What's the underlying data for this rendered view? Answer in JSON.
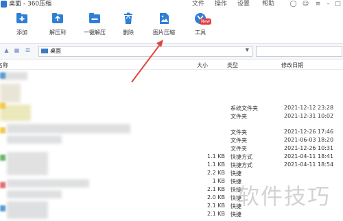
{
  "window": {
    "title": "桌面 - 360压缩",
    "menus": [
      "文件",
      "操作",
      "设置",
      "帮助"
    ]
  },
  "toolbar": {
    "items": [
      {
        "label": "添加",
        "icon": "add-icon"
      },
      {
        "label": "解压到",
        "icon": "extract-to-icon"
      },
      {
        "label": "一键解压",
        "icon": "one-click-extract-icon"
      },
      {
        "label": "删除",
        "icon": "delete-icon"
      },
      {
        "label": "图片压缩",
        "icon": "image-compress-icon"
      },
      {
        "label": "工具",
        "icon": "tools-icon"
      }
    ],
    "tools_badge": "New"
  },
  "address": {
    "path": "桌面"
  },
  "columns": {
    "name": "名称",
    "size": "大小",
    "type": "类型",
    "modified": "修改日期"
  },
  "files": [
    {
      "size": "",
      "type": "系统文件夹",
      "date": "2021-12-12 23:28"
    },
    {
      "size": "",
      "type": "文件夹",
      "date": "2021-12-31 10:02"
    },
    {
      "size": "",
      "type": "文件夹",
      "date": "2021-12-26 17:46"
    },
    {
      "size": "",
      "type": "文件夹",
      "date": "2021-06-03 18:20"
    },
    {
      "size": "",
      "type": "文件夹",
      "date": "2021-12-26 10:31"
    },
    {
      "size": "1.1 KB",
      "type": "快捷方式",
      "date": "2021-04-11 18:41"
    },
    {
      "size": "1.1 KB",
      "type": "快捷方式",
      "date": "2021-04-11 18:54"
    },
    {
      "size": "2.2 KB",
      "type": "快捷",
      "date": ""
    },
    {
      "size": "1 KB",
      "type": "快捷",
      "date": ""
    },
    {
      "size": "2.1 KB",
      "type": "快捷",
      "date": ""
    },
    {
      "size": "2.0 KB",
      "type": "快捷",
      "date": ""
    },
    {
      "size": "2.1 KB",
      "type": "快捷",
      "date": ""
    },
    {
      "size": "2.1 KB",
      "type": "快捷",
      "date": ""
    }
  ],
  "watermark": "软件技巧",
  "colors": {
    "accent": "#2e78d0",
    "annotation_arrow": "#e0463a"
  }
}
